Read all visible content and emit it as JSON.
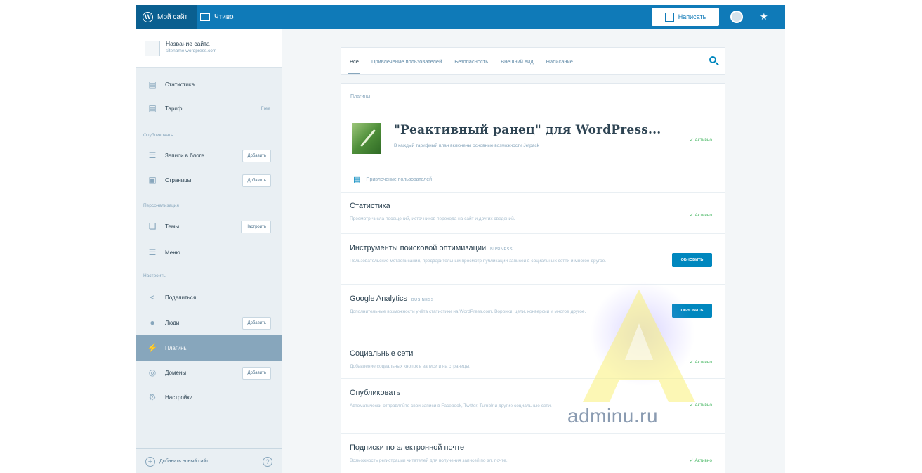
{
  "masterbar": {
    "my_site": "Мой сайт",
    "reader": "Чтиво",
    "write": "Написать"
  },
  "sidebar": {
    "site_name": "Название сайта",
    "site_url": "sitename.wordpress.com",
    "stats": "Статистика",
    "plan": "Тариф",
    "plan_value": "Free",
    "section_publish": "Опубликовать",
    "blog_posts": "Записи в блоге",
    "pages": "Страницы",
    "section_personalize": "Персонализация",
    "themes": "Темы",
    "menus": "Меню",
    "section_configure": "Настроить",
    "sharing": "Поделиться",
    "people": "Люди",
    "plugins": "Плагины",
    "domains": "Домены",
    "settings": "Настройки",
    "add_label": "Добавить",
    "customize_label": "Настроить",
    "add_new_site": "Добавить новый сайт"
  },
  "tabs": {
    "all": "Всё",
    "engagement": "Привлечение пользователей",
    "security": "Безопасность",
    "appearance": "Внешний вид",
    "writing": "Написание"
  },
  "plugins": {
    "header": "Плагины",
    "jetpack_title": "\"Реактивный ранец\" для WordPress...",
    "jetpack_desc": "В каждый тарифный план включены основные возможности Jetpack",
    "active_label": "Активно",
    "group_label": "Привлечение пользователей",
    "business_badge": "business",
    "update_label": "Обновить",
    "rows": [
      {
        "name": "Статистика",
        "desc": "Просмотр числа посещений, источников перехода на сайт и других сведений."
      },
      {
        "name": "Инструменты поисковой оптимизации",
        "desc": "Пользовательские метаописания, предварительный просмотр публикаций записей в социальных сетях и многое другое."
      },
      {
        "name": "Google Analytics",
        "desc": "Дополнительные возможности учёта статистики на WordPress.com. Воронки, цели, конверсии и многое другое."
      },
      {
        "name": "Социальные сети",
        "desc": "Добавление социальных кнопок в записи и на страницы."
      },
      {
        "name": "Опубликовать",
        "desc": "Автоматически отправляйте свои записи в Facebook, Twitter, Tumblr и другие социальные сети."
      },
      {
        "name": "Подписки по электронной почте",
        "desc": "Возможность регистрации читателей для получения записей по эл. почте."
      }
    ]
  },
  "watermark": {
    "text": "adminu.ru",
    "letter": "A"
  }
}
